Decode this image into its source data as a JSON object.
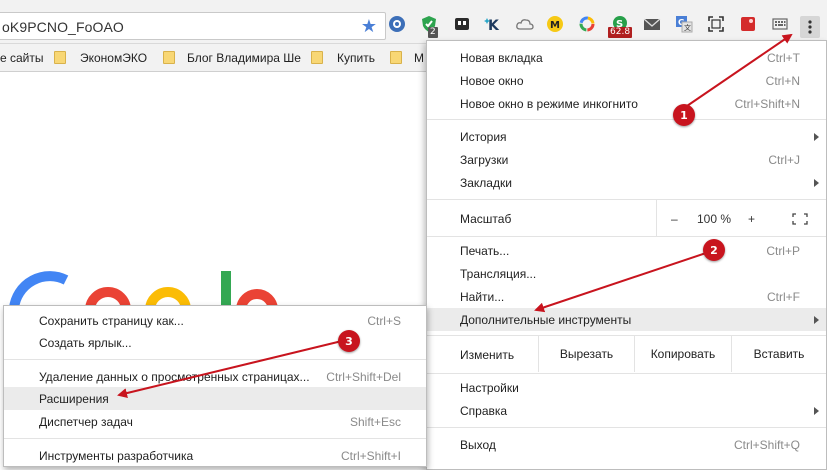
{
  "omnibox": {
    "url": "oK9PCNO_FoOAO"
  },
  "extensions": [
    {
      "icon": "blue-circle-extension-icon",
      "badge": ""
    },
    {
      "icon": "green-shield-extension-icon",
      "badge": "2"
    },
    {
      "icon": "dark-square-extension-icon",
      "badge": ""
    },
    {
      "icon": "k-sparkle-extension-icon",
      "badge": ""
    },
    {
      "icon": "cloud-extension-icon",
      "badge": ""
    },
    {
      "icon": "yellow-m-extension-icon",
      "badge": ""
    },
    {
      "icon": "color-ring-extension-icon",
      "badge": ""
    },
    {
      "icon": "green-s-extension-icon",
      "badge": "62.8"
    },
    {
      "icon": "mail-extension-icon",
      "badge": ""
    },
    {
      "icon": "translate-extension-icon",
      "badge": ""
    },
    {
      "icon": "screenshot-extension-icon",
      "badge": ""
    },
    {
      "icon": "red-square-extension-icon",
      "badge": ""
    },
    {
      "icon": "keyboard-extension-icon",
      "badge": ""
    }
  ],
  "bookmarks": [
    "е сайты",
    "ЭкономЭКО",
    "Блог Владимира Ше",
    "Купить",
    "М"
  ],
  "menu": {
    "new_tab": {
      "label": "Новая вкладка",
      "shortcut": "Ctrl+T"
    },
    "new_window": {
      "label": "Новое окно",
      "shortcut": "Ctrl+N"
    },
    "incognito": {
      "label": "Новое окно в режиме инкогнито",
      "shortcut": "Ctrl+Shift+N"
    },
    "history": {
      "label": "История"
    },
    "downloads": {
      "label": "Загрузки",
      "shortcut": "Ctrl+J"
    },
    "bookmarks": {
      "label": "Закладки"
    },
    "zoom": {
      "label": "Масштаб",
      "minus": "–",
      "value": "100 %",
      "plus": "+"
    },
    "print": {
      "label": "Печать...",
      "shortcut": "Ctrl+P"
    },
    "cast": {
      "label": "Трансляция..."
    },
    "find": {
      "label": "Найти...",
      "shortcut": "Ctrl+F"
    },
    "more_tools": {
      "label": "Дополнительные инструменты"
    },
    "edit": {
      "label": "Изменить",
      "cut": "Вырезать",
      "copy": "Копировать",
      "paste": "Вставить"
    },
    "settings": {
      "label": "Настройки"
    },
    "help": {
      "label": "Справка"
    },
    "exit": {
      "label": "Выход",
      "shortcut": "Ctrl+Shift+Q"
    }
  },
  "submenu": {
    "save_page": {
      "label": "Сохранить страницу как...",
      "shortcut": "Ctrl+S"
    },
    "create_shortcut": {
      "label": "Создать ярлык..."
    },
    "clear_data": {
      "label": "Удаление данных о просмотренных страницах...",
      "shortcut": "Ctrl+Shift+Del"
    },
    "extensions": {
      "label": "Расширения"
    },
    "task_manager": {
      "label": "Диспетчер задач",
      "shortcut": "Shift+Esc"
    },
    "dev_tools": {
      "label": "Инструменты разработчика",
      "shortcut": "Ctrl+Shift+I"
    }
  },
  "callouts": [
    "1",
    "2",
    "3"
  ],
  "colors": {
    "callout": "#c8141e",
    "menu_highlight": "#ebebeb",
    "star": "#4a7fd6"
  }
}
